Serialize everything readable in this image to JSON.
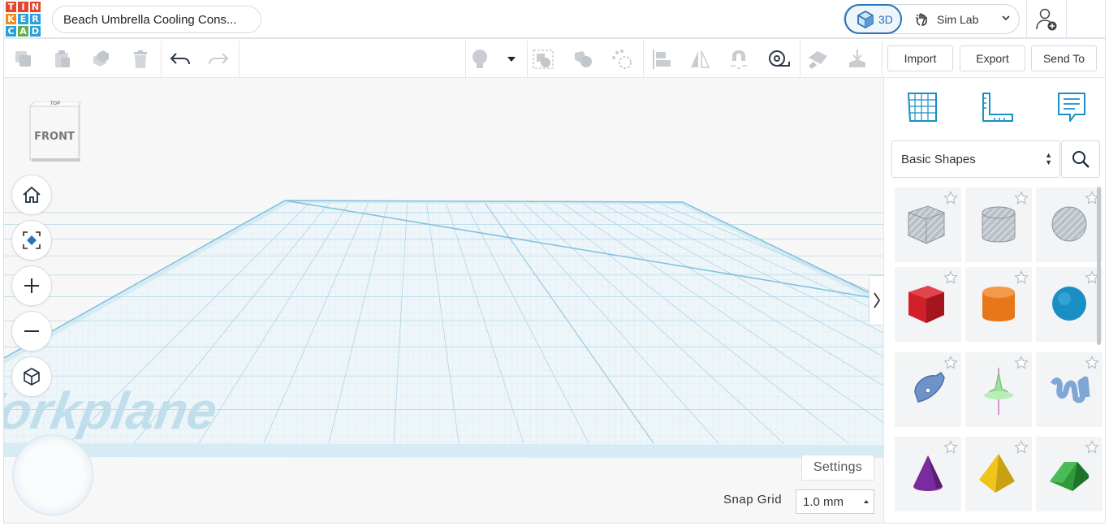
{
  "app": {
    "logo_letters": [
      "T",
      "I",
      "N",
      "K",
      "E",
      "R",
      "C",
      "A",
      "D"
    ],
    "logo_colors": [
      "#e5452c",
      "#e5452c",
      "#e5452c",
      "#f08c1a",
      "#2a9fd8",
      "#2a9fd8",
      "#2a9fd8",
      "#60b248",
      "#2a9fd8"
    ],
    "design_title": "Beach Umbrella Cooling Cons..."
  },
  "mode": {
    "active_label": "3D",
    "sim_label": "Sim Lab",
    "accent": "#2b73b9"
  },
  "toolbar": {
    "import_label": "Import",
    "export_label": "Export",
    "send_to_label": "Send To",
    "icons": [
      "copy-icon",
      "paste-icon",
      "duplicate-icon",
      "delete-icon",
      "undo-icon",
      "redo-icon",
      "light-bulb-icon",
      "dropdown-icon",
      "group-icon",
      "ungroup-icon",
      "hole-icon",
      "align-icon",
      "mirror-icon",
      "cruise-icon",
      "ruler-icon",
      "note-icon",
      "drop-icon"
    ]
  },
  "viewport": {
    "viewcube_top": "TOP",
    "viewcube_front": "FRONT",
    "workplane_label": "Workplane",
    "settings_label": "Settings",
    "snap_grid_label": "Snap Grid",
    "snap_grid_value": "1.0 mm",
    "nav_icons": [
      "home-icon",
      "fit-view-icon",
      "zoom-in-icon",
      "zoom-out-icon",
      "projection-icon"
    ]
  },
  "panel": {
    "tab_icons": [
      "workplane-grid-icon",
      "ruler-tool-icon",
      "notes-icon"
    ],
    "category": "Basic Shapes",
    "shapes": [
      {
        "name": "Box (hole)",
        "icon": "box-hole-icon",
        "color": "#9aa3ad"
      },
      {
        "name": "Cylinder (hole)",
        "icon": "cylinder-hole-icon",
        "color": "#9aa3ad"
      },
      {
        "name": "Sphere (hole)",
        "icon": "sphere-hole-icon",
        "color": "#9aa3ad"
      },
      {
        "name": "Box",
        "icon": "box-icon",
        "color": "#d0202a"
      },
      {
        "name": "Cylinder",
        "icon": "cylinder-icon",
        "color": "#e8761b"
      },
      {
        "name": "Sphere",
        "icon": "sphere-icon",
        "color": "#1a8fc4"
      },
      {
        "name": "Scribble",
        "icon": "scribble-icon",
        "color": "#6f92c9"
      },
      {
        "name": "Shape Generator",
        "icon": "shape-generator-icon",
        "color": "#9be39b"
      },
      {
        "name": "Text",
        "icon": "text-shape-icon",
        "color": "#7fa6d6"
      },
      {
        "name": "Cone",
        "icon": "cone-icon",
        "color": "#7a2c9e"
      },
      {
        "name": "Pyramid",
        "icon": "pyramid-icon",
        "color": "#f0c419"
      },
      {
        "name": "Roof",
        "icon": "roof-icon",
        "color": "#2e9a3a"
      }
    ]
  }
}
